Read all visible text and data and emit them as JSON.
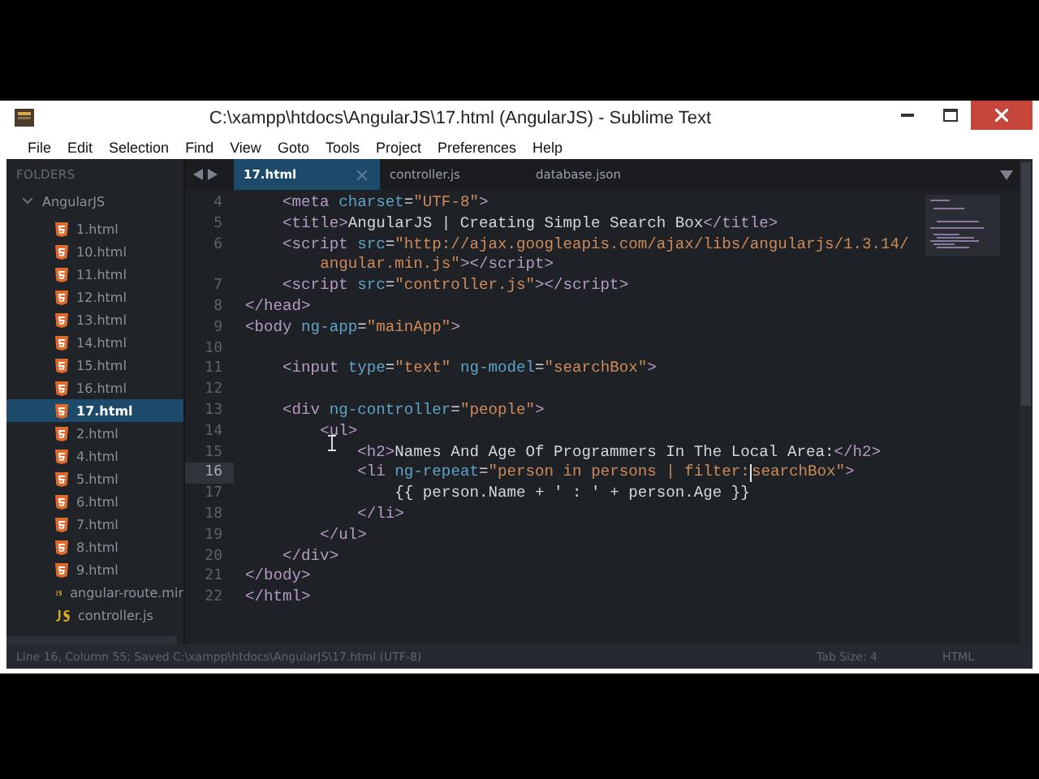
{
  "window": {
    "title": "C:\\xampp\\htdocs\\AngularJS\\17.html (AngularJS) - Sublime Text"
  },
  "menu": [
    "File",
    "Edit",
    "Selection",
    "Find",
    "View",
    "Goto",
    "Tools",
    "Project",
    "Preferences",
    "Help"
  ],
  "sidebar": {
    "header": "FOLDERS",
    "folder": {
      "name": "AngularJS",
      "expanded": true,
      "children": [
        {
          "name": "1.html",
          "kind": "html",
          "selected": false
        },
        {
          "name": "10.html",
          "kind": "html",
          "selected": false
        },
        {
          "name": "11.html",
          "kind": "html",
          "selected": false
        },
        {
          "name": "12.html",
          "kind": "html",
          "selected": false
        },
        {
          "name": "13.html",
          "kind": "html",
          "selected": false
        },
        {
          "name": "14.html",
          "kind": "html",
          "selected": false
        },
        {
          "name": "15.html",
          "kind": "html",
          "selected": false
        },
        {
          "name": "16.html",
          "kind": "html",
          "selected": false
        },
        {
          "name": "17.html",
          "kind": "html",
          "selected": true
        },
        {
          "name": "2.html",
          "kind": "html",
          "selected": false
        },
        {
          "name": "4.html",
          "kind": "html",
          "selected": false
        },
        {
          "name": "5.html",
          "kind": "html",
          "selected": false
        },
        {
          "name": "6.html",
          "kind": "html",
          "selected": false
        },
        {
          "name": "7.html",
          "kind": "html",
          "selected": false
        },
        {
          "name": "8.html",
          "kind": "html",
          "selected": false
        },
        {
          "name": "9.html",
          "kind": "html",
          "selected": false
        },
        {
          "name": "angular-route.mir",
          "kind": "js",
          "selected": false
        },
        {
          "name": "controller.js",
          "kind": "js",
          "selected": false
        }
      ]
    }
  },
  "tabs": [
    {
      "label": "17.html",
      "selected": true
    },
    {
      "label": "controller.js",
      "selected": false
    },
    {
      "label": "database.json",
      "selected": false
    }
  ],
  "editor": {
    "lines": [
      {
        "number": "4",
        "current": false,
        "tokens": [
          {
            "kind": "tag",
            "text": "    <meta"
          },
          {
            "kind": "attr",
            "text": " charset"
          },
          {
            "kind": "plain",
            "text": "="
          },
          {
            "kind": "string",
            "text": "\"UTF-8\""
          },
          {
            "kind": "tag",
            "text": ">"
          }
        ]
      },
      {
        "number": "5",
        "current": false,
        "tokens": [
          {
            "kind": "tag",
            "text": "    <title>"
          },
          {
            "kind": "plain",
            "text": "AngularJS | Creating Simple Search Box"
          },
          {
            "kind": "tag",
            "text": "</title>"
          }
        ]
      },
      {
        "number": "6",
        "current": false,
        "tokens": [
          {
            "kind": "tag",
            "text": "    <script"
          },
          {
            "kind": "attr",
            "text": " src"
          },
          {
            "kind": "plain",
            "text": "="
          },
          {
            "kind": "string",
            "text": "\"http://ajax.googleapis.com/ajax/libs/angularjs/1.3.14/"
          }
        ]
      },
      {
        "tokens": [
          {
            "kind": "string",
            "text": "        angular.min.js\""
          },
          {
            "kind": "tag",
            "text": "></script>"
          }
        ]
      },
      {
        "number": "7",
        "current": false,
        "tokens": [
          {
            "kind": "tag",
            "text": "    <script"
          },
          {
            "kind": "attr",
            "text": " src"
          },
          {
            "kind": "plain",
            "text": "="
          },
          {
            "kind": "string",
            "text": "\"controller.js\""
          },
          {
            "kind": "tag",
            "text": "></script>"
          }
        ]
      },
      {
        "number": "8",
        "current": false,
        "tokens": [
          {
            "kind": "tag",
            "text": "</head>"
          }
        ]
      },
      {
        "number": "9",
        "current": false,
        "tokens": [
          {
            "kind": "tag",
            "text": "<body"
          },
          {
            "kind": "attr",
            "text": " ng-app"
          },
          {
            "kind": "plain",
            "text": "="
          },
          {
            "kind": "string",
            "text": "\"mainApp\""
          },
          {
            "kind": "tag",
            "text": ">"
          }
        ]
      },
      {
        "number": "10",
        "current": false
      },
      {
        "number": "11",
        "current": false,
        "tokens": [
          {
            "kind": "tag",
            "text": "    <input"
          },
          {
            "kind": "attr",
            "text": " type"
          },
          {
            "kind": "plain",
            "text": "="
          },
          {
            "kind": "string",
            "text": "\"text\""
          },
          {
            "kind": "attr",
            "text": " ng-model"
          },
          {
            "kind": "plain",
            "text": "="
          },
          {
            "kind": "string",
            "text": "\"searchBox\""
          },
          {
            "kind": "tag",
            "text": ">"
          }
        ]
      },
      {
        "number": "12",
        "current": false
      },
      {
        "number": "13",
        "current": false,
        "tokens": [
          {
            "kind": "tag",
            "text": "    <div"
          },
          {
            "kind": "attr",
            "text": " ng-controller"
          },
          {
            "kind": "plain",
            "text": "="
          },
          {
            "kind": "string",
            "text": "\"people\""
          },
          {
            "kind": "tag",
            "text": ">"
          }
        ]
      },
      {
        "number": "14",
        "current": false,
        "tokens": [
          {
            "kind": "tag",
            "text": "        <ul>"
          }
        ]
      },
      {
        "number": "15",
        "current": false,
        "tokens": [
          {
            "kind": "tag",
            "text": "            <h2>"
          },
          {
            "kind": "plain",
            "text": "Names And Age Of Programmers In The Local Area:"
          },
          {
            "kind": "tag",
            "text": "</h2>"
          }
        ]
      },
      {
        "number": "16",
        "current": true,
        "tokens": [
          {
            "kind": "tag",
            "text": "            <li"
          },
          {
            "kind": "attr",
            "text": " ng-repeat"
          },
          {
            "kind": "plain",
            "text": "="
          },
          {
            "kind": "string",
            "text": "\"person in persons | filter:"
          },
          {
            "kind": "caret"
          },
          {
            "kind": "string",
            "text": "searchBox\""
          },
          {
            "kind": "tag",
            "text": ">"
          }
        ]
      },
      {
        "number": "17",
        "current": false,
        "tokens": [
          {
            "kind": "plain",
            "text": "                {{ person.Name + ' : ' + person.Age }}"
          }
        ]
      },
      {
        "number": "18",
        "current": false,
        "tokens": [
          {
            "kind": "tag",
            "text": "            </li>"
          }
        ]
      },
      {
        "number": "19",
        "current": false,
        "tokens": [
          {
            "kind": "tag",
            "text": "        </ul>"
          }
        ]
      },
      {
        "number": "20",
        "current": false,
        "tokens": [
          {
            "kind": "tag",
            "text": "    </div>"
          }
        ]
      },
      {
        "number": "21",
        "current": false,
        "tokens": [
          {
            "kind": "tag",
            "text": "</body>"
          }
        ]
      },
      {
        "number": "22",
        "current": false,
        "tokens": [
          {
            "kind": "tag",
            "text": "</html>"
          }
        ]
      }
    ]
  },
  "status_bar": {
    "message": "Line 16, Column 55; Saved C:\\xampp\\htdocs\\AngularJS\\17.html (UTF-8)",
    "tab_size": "Tab Size: 4",
    "syntax": "HTML"
  }
}
